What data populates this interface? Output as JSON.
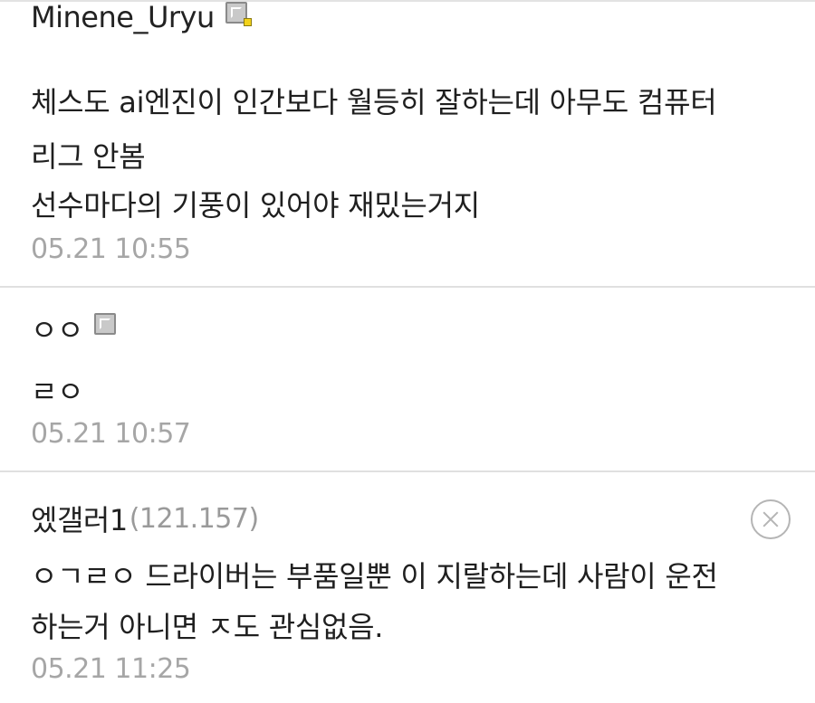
{
  "comments": [
    {
      "author": "Minene_Uryu",
      "ip": "",
      "has_mobile_icon": true,
      "lines": [
        "체스도 ai엔진이 인간보다 월등히 잘하는데 아무도 컴퓨터",
        "리그 안봄",
        "선수마다의 기풍이 있어야 재밌는거지"
      ],
      "time": "05.21 10:55"
    },
    {
      "author": "ㅇㅇ",
      "ip": "",
      "has_mobile_icon": true,
      "lines": [
        "ㄹㅇ"
      ],
      "time": "05.21 10:57"
    },
    {
      "author": "엤갤러1",
      "ip": "(121.157)",
      "has_mobile_icon": false,
      "lines": [
        "ㅇㄱㄹㅇ 드라이버는 부품일뿐 이 지랄하는데 사람이 운전",
        "하는거 아니면 ㅈ도 관심없음."
      ],
      "time": "05.21 11:25"
    }
  ],
  "icons": {
    "mobile": "mobile-device-icon",
    "delete": "delete-circle-x-icon"
  },
  "colors": {
    "text": "#1f1f1f",
    "meta": "#a6a6a6",
    "divider": "#e0e0e0",
    "mobile_badge": "#f2d21a"
  }
}
